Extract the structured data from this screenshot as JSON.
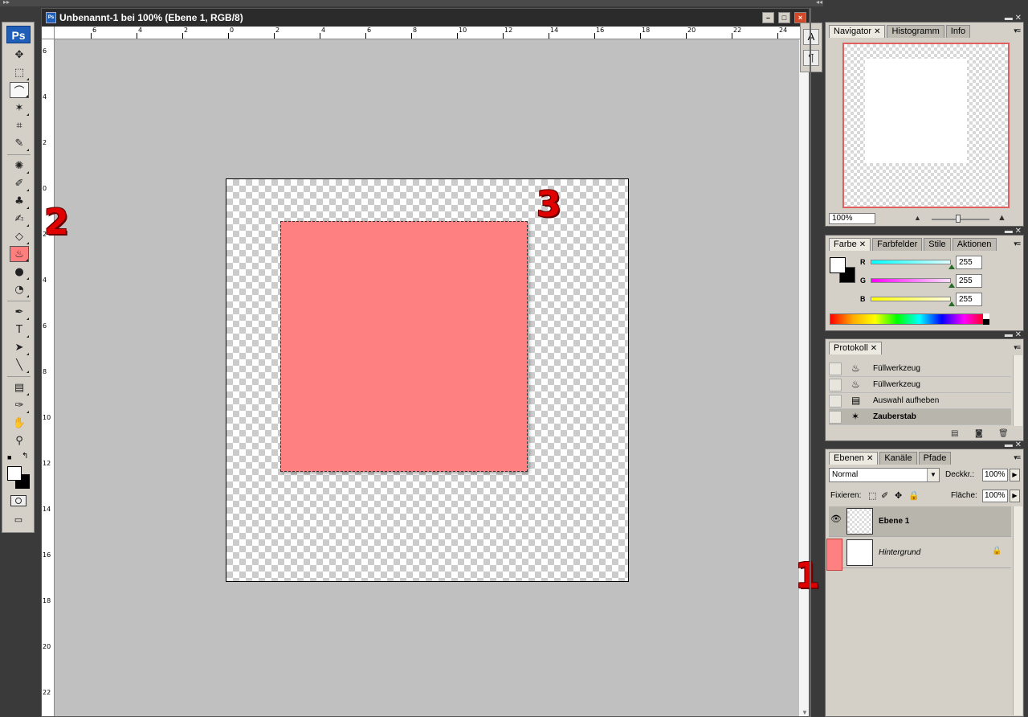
{
  "document": {
    "title": "Unbenannt-1 bei 100% (Ebene 1, RGB/8)",
    "ruler_h": [
      "6",
      "4",
      "2",
      "0",
      "2",
      "4",
      "6",
      "8",
      "10",
      "12",
      "14",
      "16",
      "18",
      "20",
      "22",
      "24"
    ],
    "ruler_v": [
      "6",
      "4",
      "2",
      "0",
      "2",
      "4",
      "6",
      "8",
      "10",
      "12",
      "14",
      "16",
      "18",
      "20",
      "22"
    ]
  },
  "toolbox": {
    "logo": "Ps",
    "tools": [
      {
        "name": "move-tool",
        "glyph": "✥"
      },
      {
        "name": "marquee-tool",
        "glyph": "⬚"
      },
      {
        "name": "lasso-tool",
        "glyph": "⌒"
      },
      {
        "name": "magic-wand-tool",
        "glyph": "✶"
      },
      {
        "name": "crop-tool",
        "glyph": "⌗"
      },
      {
        "name": "eyedropper-slice-tool",
        "glyph": "✎"
      },
      {
        "name": "healing-brush-tool",
        "glyph": "✺"
      },
      {
        "name": "brush-tool",
        "glyph": "✐"
      },
      {
        "name": "clone-stamp-tool",
        "glyph": "♣"
      },
      {
        "name": "history-brush-tool",
        "glyph": "✍"
      },
      {
        "name": "eraser-tool",
        "glyph": "◇"
      },
      {
        "name": "paint-bucket-tool",
        "glyph": "♨"
      },
      {
        "name": "blur-tool",
        "glyph": "●"
      },
      {
        "name": "dodge-tool",
        "glyph": "◔"
      },
      {
        "name": "pen-tool",
        "glyph": "✒"
      },
      {
        "name": "type-tool",
        "glyph": "T"
      },
      {
        "name": "path-selection-tool",
        "glyph": "➤"
      },
      {
        "name": "line-tool",
        "glyph": "╲"
      },
      {
        "name": "notes-tool",
        "glyph": "▤"
      },
      {
        "name": "eyedropper-tool",
        "glyph": "✑"
      },
      {
        "name": "hand-tool",
        "glyph": "✋"
      },
      {
        "name": "zoom-tool",
        "glyph": "⚲"
      }
    ]
  },
  "markers": [
    "1",
    "2",
    "3"
  ],
  "navigator": {
    "tabs": [
      "Navigator",
      "Histogramm",
      "Info"
    ],
    "zoom": "100%"
  },
  "color": {
    "tabs": [
      "Farbe",
      "Farbfelder",
      "Stile",
      "Aktionen"
    ],
    "channels": [
      {
        "label": "R",
        "value": "255"
      },
      {
        "label": "G",
        "value": "255"
      },
      {
        "label": "B",
        "value": "255"
      }
    ]
  },
  "history": {
    "tabs": [
      "Protokoll"
    ],
    "items": [
      {
        "label": "Füllwerkzeug",
        "icon": "♨"
      },
      {
        "label": "Füllwerkzeug",
        "icon": "♨"
      },
      {
        "label": "Auswahl aufheben",
        "icon": "▤"
      },
      {
        "label": "Zauberstab",
        "icon": "✶"
      }
    ]
  },
  "layers": {
    "tabs": [
      "Ebenen",
      "Kanäle",
      "Pfade"
    ],
    "blend_mode": "Normal",
    "opacity_label": "Deckkr.:",
    "opacity": "100%",
    "lock_label": "Fixieren:",
    "fill_label": "Fläche:",
    "fill": "100%",
    "items": [
      {
        "name": "Ebene 1"
      },
      {
        "name": "Hintergrund"
      }
    ]
  },
  "colors": {
    "fill": "#ff8080",
    "marker": "#e00000"
  }
}
